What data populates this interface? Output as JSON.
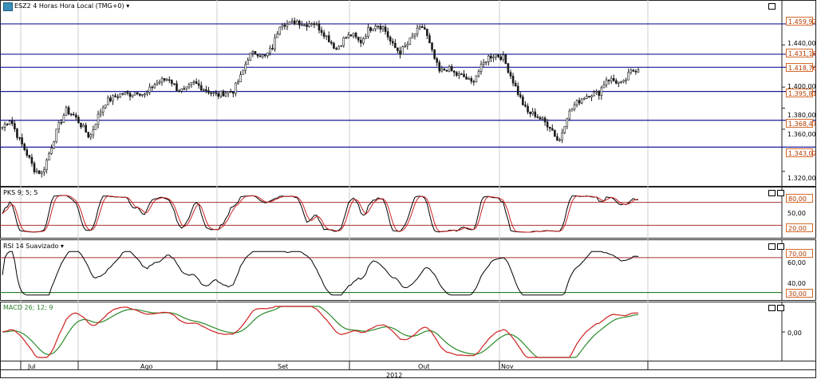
{
  "header": {
    "badge": "ES",
    "title": "ESZ2 4 Horas Hora Local (TMG+0)",
    "title_caret": "▾"
  },
  "colors": {
    "hline": "#1a1a9c",
    "candle_up": "#1a1a1a",
    "candle_down": "#1a1a1a",
    "pks_fast": "#000000",
    "pks_slow": "#cc2222",
    "pks_levels": "#a33",
    "rsi_line": "#000000",
    "rsi_upper": "#a33",
    "rsi_lower": "#2a7a2a",
    "macd_line": "#cc2222",
    "macd_signal": "#2a8a2a",
    "grid": "#cccccc",
    "tag_text": "#b33a00"
  },
  "chart_data": [
    {
      "type": "candlestick",
      "title": "ESZ2 4 Horas Hora Local (TMG+0)",
      "ylim": [
        1310,
        1472
      ],
      "yticks": [
        "1.440,00",
        "1.400,00",
        "1.380,00",
        "1.360,00",
        "1.320,00"
      ],
      "ytick_values": [
        1440,
        1400,
        1380,
        1360,
        1320
      ],
      "horizontal_levels": [
        {
          "value": 1459.92,
          "label": "1.459,92"
        },
        {
          "value": 1431.18,
          "label": "1.431,18"
        },
        {
          "value": 1418.76,
          "label": "1.418,76"
        },
        {
          "value": 1395.81,
          "label": "1.395,81"
        },
        {
          "value": 1368.47,
          "label": "1.368,47"
        },
        {
          "value": 1343.02,
          "label": "1.343,02"
        }
      ],
      "months": [
        "Jul",
        "Ago",
        "Set",
        "Out",
        "Nov"
      ],
      "year": "2012",
      "close_anchors": [
        1362,
        1370,
        1352,
        1338,
        1322,
        1318,
        1340,
        1362,
        1378,
        1373,
        1363,
        1352,
        1372,
        1386,
        1390,
        1394,
        1393,
        1396,
        1392,
        1402,
        1406,
        1408,
        1398,
        1396,
        1404,
        1400,
        1396,
        1392,
        1395,
        1396,
        1410,
        1430,
        1433,
        1428,
        1438,
        1462,
        1459,
        1463,
        1459,
        1462,
        1455,
        1446,
        1436,
        1446,
        1450,
        1442,
        1454,
        1460,
        1456,
        1440,
        1433,
        1441,
        1452,
        1458,
        1434,
        1414,
        1418,
        1412,
        1410,
        1404,
        1416,
        1428,
        1431,
        1428,
        1410,
        1392,
        1376,
        1374,
        1368,
        1362,
        1347,
        1372,
        1383,
        1390,
        1394,
        1394,
        1408,
        1406,
        1402,
        1414,
        1418
      ]
    },
    {
      "type": "line",
      "title": "PKS 9; 5; 5",
      "ylim": [
        0,
        100
      ],
      "yticks": [
        "50,00"
      ],
      "ytick_values": [
        50
      ],
      "levels": [
        {
          "value": 80,
          "label": "80,00"
        },
        {
          "value": 20,
          "label": "20,00"
        }
      ],
      "series": [
        {
          "values": []
        },
        {
          "values": []
        }
      ]
    },
    {
      "type": "line",
      "title": "RSI 14 Suavizado",
      "ylim": [
        25,
        80
      ],
      "yticks": [
        "60,00",
        "40,00"
      ],
      "ytick_values": [
        60,
        40
      ],
      "levels": [
        {
          "value": 70,
          "label": "70,00"
        },
        {
          "value": 30,
          "label": "30,00"
        }
      ]
    },
    {
      "type": "line",
      "title": "MACD 26; 12; 9",
      "ylim": [
        -10,
        10
      ],
      "yticks": [
        "0,00"
      ],
      "ytick_values": [
        0
      ]
    }
  ],
  "labels": {
    "pks_title": "PKS 9; 5; 5",
    "rsi_title": "RSI 14 Suavizado",
    "rsi_caret": "▾",
    "macd_title": "MACD 26; 12; 9",
    "price_ticks": [
      "1.440,00",
      "1.400,00",
      "1.380,00",
      "1.360,00",
      "1.320,00"
    ],
    "price_tags": [
      "1.459,92",
      "1.431,18",
      "1.418,76",
      "1.395,81",
      "1.368,47",
      "1.343,02"
    ],
    "pks_ticks": [
      "80,00",
      "50,00",
      "20,00"
    ],
    "rsi_ticks": [
      "70,00",
      "60,00",
      "40,00",
      "30,00"
    ],
    "macd_ticks": [
      "0,00"
    ],
    "months": [
      "Jul",
      "Ago",
      "Set",
      "Out",
      "Nov"
    ],
    "year": "2012"
  }
}
